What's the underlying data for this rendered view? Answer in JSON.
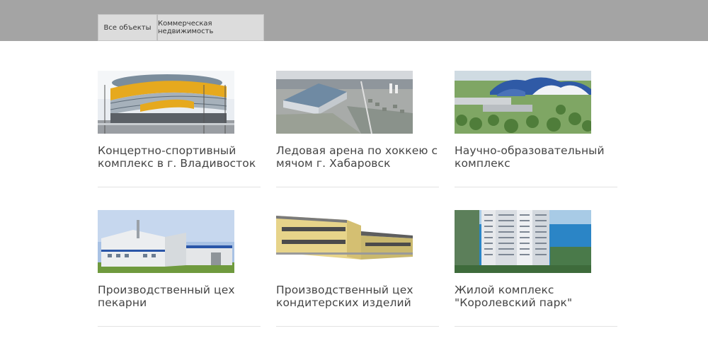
{
  "filter_tabs": [
    {
      "label": "Все объекты"
    },
    {
      "label": "Коммерческая недвижимость"
    }
  ],
  "projects": [
    {
      "title": "Концертно-спортивный комплекс в г. Владивосток"
    },
    {
      "title": "Ледовая арена по хоккею с мячом г. Хабаровск"
    },
    {
      "title": "Научно-образовательный комплекс"
    },
    {
      "title": "Производственный цех пекарни"
    },
    {
      "title": "Производственный цех кондитерских изделий"
    },
    {
      "title": "Жилой комплекс \"Королевский парк\""
    }
  ]
}
